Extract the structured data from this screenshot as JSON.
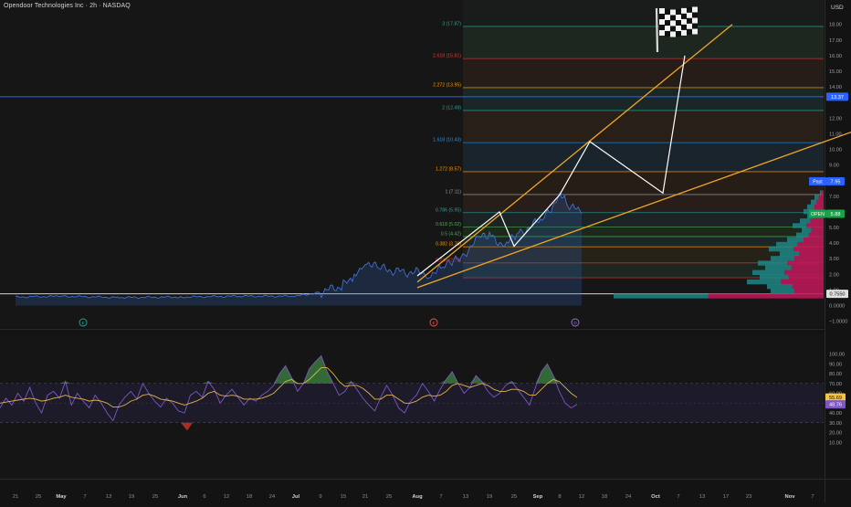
{
  "header": {
    "symbol_title": "Opendoor Technologies Inc · 2h · NASDAQ",
    "currency": "USD"
  },
  "colors": {
    "background": "#131313",
    "price_line": "#3f6fd6",
    "price_fill": "#2f5ea8",
    "fib_zone_fill": "#2b2219",
    "trend_orange": "#f5a623",
    "projection_white": "#ffffff",
    "profile_pink": "#c2185b",
    "profile_teal": "#1e8c8c",
    "rsi_line": "#7e57c2",
    "rsi_ma_line": "#e0b44a",
    "blue_level_line": "#2962ff",
    "open_label": "#16a34a",
    "past_label": "#2962ff",
    "rsi_band": "#1f1b2e"
  },
  "icons": {
    "finish_flag": "checkered-flag-icon",
    "earnings_marker_1": "earnings-e-icon",
    "earnings_marker_2": "earnings-e-icon",
    "earnings_marker_3": "dividend-d-icon"
  },
  "event_markers": [
    "E",
    "E",
    "D"
  ],
  "chart_data": [
    {
      "type": "area",
      "title": "Opendoor Technologies Inc · 2h · NASDAQ",
      "xlabel": "",
      "ylabel": "USD",
      "ylim": [
        -1,
        19
      ],
      "grid": false,
      "x_tick_labels": [
        "21",
        "25",
        "May",
        "7",
        "13",
        "19",
        "25",
        "Jun",
        "6",
        "12",
        "18",
        "24",
        "Jul",
        "9",
        "15",
        "21",
        "25",
        "Aug",
        "7",
        "13",
        "19",
        "25",
        "Sep",
        "8",
        "12",
        "18",
        "24",
        "Oct",
        "7",
        "13",
        "17",
        "23",
        "Nov",
        "7"
      ],
      "y_tick_labels": [
        "18.00",
        "17.00",
        "16.00",
        "15.00",
        "14.00",
        "12.00",
        "11.00",
        "10.00",
        "9.00",
        "7.00",
        "6.00",
        "5.00",
        "4.00",
        "3.00",
        "2.00",
        "1.00",
        "0.0000",
        "−1.0000"
      ],
      "price_series": {
        "x": [
          "Apr 21",
          "May 1",
          "May 15",
          "Jun 1",
          "Jun 15",
          "Jul 1",
          "Jul 10",
          "Jul 15",
          "Jul 18",
          "Jul 21",
          "Jul 24",
          "Jul 29",
          "Aug 4",
          "Aug 7",
          "Aug 11",
          "Aug 15",
          "Aug 19",
          "Aug 22",
          "Aug 26",
          "Aug 29",
          "Sep 3",
          "Sep 8",
          "Sep 10",
          "Sep 12"
        ],
        "values": [
          0.55,
          0.6,
          0.52,
          0.55,
          0.6,
          0.6,
          0.85,
          1.3,
          1.9,
          2.9,
          2.4,
          2.2,
          2.05,
          2.3,
          2.85,
          3.5,
          4.3,
          4.55,
          3.8,
          4.55,
          5.6,
          7.1,
          6.6,
          5.88
        ]
      },
      "fib_levels": [
        {
          "ratio": "0.236",
          "price": 2.73,
          "label": "0.236 (2.73)"
        },
        {
          "ratio": "0.382",
          "price": 3.76,
          "label": "0.382 (3.76)"
        },
        {
          "ratio": "0.5",
          "price": 4.42,
          "label": "0.5 (4.42)"
        },
        {
          "ratio": "0.618",
          "price": 5.02,
          "label": "0.618 (5.02)"
        },
        {
          "ratio": "0.786",
          "price": 5.95,
          "label": "0.786 (5.95)"
        },
        {
          "ratio": "1",
          "price": 7.11,
          "label": "1 (7.11)"
        },
        {
          "ratio": "1.272",
          "price": 8.57,
          "label": "1.272 (8.57)"
        },
        {
          "ratio": "1.618",
          "price": 10.43,
          "label": "1.618 (10.43)"
        },
        {
          "ratio": "2",
          "price": 12.49,
          "label": "2 (12.49)"
        },
        {
          "ratio": "2.272",
          "price": 13.95,
          "label": "2.272 (13.95)"
        },
        {
          "ratio": "2.618",
          "price": 15.81,
          "label": "2.618 (15.81)"
        },
        {
          "ratio": "3",
          "price": 17.87,
          "label": "3 (17.87)"
        }
      ],
      "price_labels": [
        {
          "text": "13.37",
          "price": 13.37,
          "color": "#2962ff"
        },
        {
          "text": "Past",
          "second": "7.95",
          "price": 7.95,
          "color": "#2962ff"
        },
        {
          "text": "OPEN",
          "second": "5.88",
          "price": 5.88,
          "color": "#16a34a"
        },
        {
          "text": "0.7550",
          "price": 0.755,
          "color": "#e0e0e0"
        }
      ],
      "horizontal_line": {
        "price": 13.37
      },
      "trend_lines": [
        {
          "points": [
            [
              "Aug 1",
              1.5
            ],
            [
              "Oct 25",
              18.0
            ]
          ]
        },
        {
          "points": [
            [
              "Aug 1",
              1.15
            ],
            [
              "Nov 9",
              11.1
            ]
          ]
        }
      ],
      "projection_path": {
        "points": [
          [
            "Aug 1",
            1.9
          ],
          [
            "Aug 24",
            6.0
          ],
          [
            "Aug 28",
            3.8
          ],
          [
            "Sep 8",
            7.1
          ],
          [
            "Sep 15",
            10.5
          ],
          [
            "Sep 30",
            7.2
          ],
          [
            "Oct 5",
            16.0
          ]
        ]
      },
      "annotations": [
        "checkered flag"
      ]
    },
    {
      "type": "line",
      "title": "",
      "xlabel": "",
      "ylabel": "",
      "ylim": [
        0,
        100
      ],
      "y_tick_labels": [
        "100.00",
        "90.00",
        "80.00",
        "70.00",
        "60.00",
        "50.00",
        "40.00",
        "30.00",
        "20.00",
        "10.00"
      ],
      "band": {
        "upper": 70,
        "lower": 30
      },
      "series": [
        {
          "name": "",
          "current": "48.76",
          "values": [
            45,
            55,
            48,
            60,
            52,
            66,
            50,
            40,
            58,
            62,
            55,
            72,
            48,
            60,
            52,
            45,
            58,
            50,
            40,
            32,
            48,
            56,
            62,
            54,
            70,
            60,
            52,
            46,
            55,
            50,
            42,
            40,
            58,
            62,
            56,
            72,
            64,
            50,
            58,
            64,
            56,
            48,
            55,
            52,
            58,
            62,
            68,
            80,
            88,
            76,
            62,
            70,
            85,
            92,
            98,
            82,
            70,
            58,
            62,
            72,
            64,
            55,
            48,
            42,
            56,
            68,
            58,
            45,
            40,
            52,
            58,
            70,
            62,
            52,
            64,
            74,
            82,
            70,
            60,
            66,
            78,
            72,
            62,
            56,
            60,
            68,
            72,
            64,
            56,
            48,
            66,
            82,
            90,
            78,
            62,
            50,
            45,
            48.76
          ]
        },
        {
          "name": "",
          "current": "55.69",
          "values": [
            50,
            51,
            52,
            53,
            54,
            55,
            54,
            52,
            53,
            55,
            56,
            58,
            56,
            55,
            54,
            52,
            53,
            52,
            50,
            46,
            46,
            48,
            52,
            54,
            58,
            59,
            57,
            54,
            53,
            52,
            50,
            48,
            50,
            52,
            55,
            60,
            62,
            58,
            57,
            58,
            57,
            54,
            54,
            54,
            55,
            57,
            60,
            66,
            72,
            74,
            70,
            70,
            74,
            80,
            86,
            86,
            80,
            72,
            67,
            68,
            68,
            65,
            60,
            54,
            54,
            58,
            58,
            54,
            50,
            50,
            52,
            56,
            58,
            57,
            58,
            62,
            68,
            70,
            68,
            66,
            68,
            70,
            68,
            64,
            62,
            62,
            64,
            64,
            62,
            58,
            58,
            64,
            70,
            74,
            72,
            66,
            60,
            55.69
          ]
        }
      ]
    }
  ]
}
